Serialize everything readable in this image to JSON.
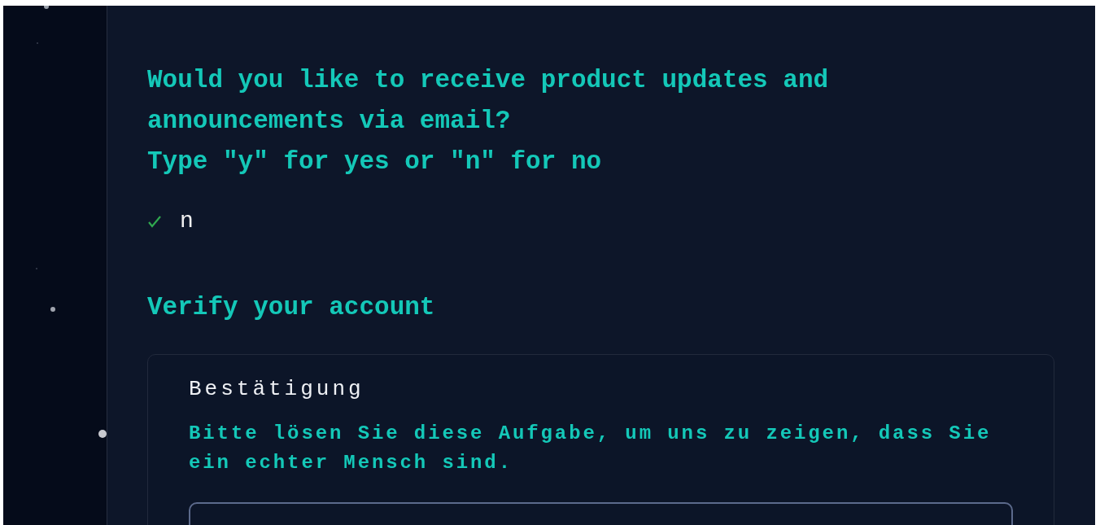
{
  "prompts": [
    {
      "question": "Would you like to receive product updates and announcements via email?",
      "hint": "Type \"y\" for yes or \"n\" for no",
      "answer": {
        "done": true,
        "value": "n"
      }
    }
  ],
  "verify": {
    "heading": "Verify your account",
    "card": {
      "title": "Bestätigung",
      "instructions": "Bitte lösen Sie diese Aufgabe, um uns zu zeigen, dass Sie ein echter Mensch sind."
    }
  }
}
